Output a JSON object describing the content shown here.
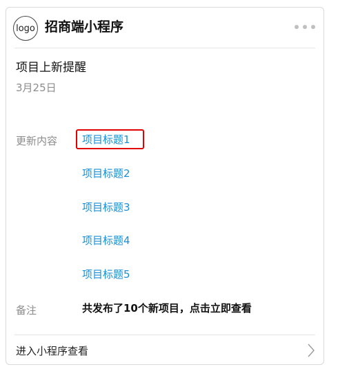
{
  "header": {
    "logo_text": "logo",
    "app_name": "招商端小程序",
    "more_icon": "more-dots-icon"
  },
  "message": {
    "title": "项目上新提醒",
    "date": "3月25日"
  },
  "fields": {
    "update_label": "更新内容",
    "items": [
      "项目标题1",
      "项目标题2",
      "项目标题3",
      "项目标题4",
      "项目标题5"
    ],
    "note_label": "备注",
    "note_text": "共发布了10个新项目，点击立即查看"
  },
  "footer": {
    "label": "进入小程序查看",
    "icon": "chevron-right-icon"
  },
  "colors": {
    "link": "#1a8fd6",
    "highlight_border": "#e00000",
    "muted": "#8c8c8c"
  }
}
